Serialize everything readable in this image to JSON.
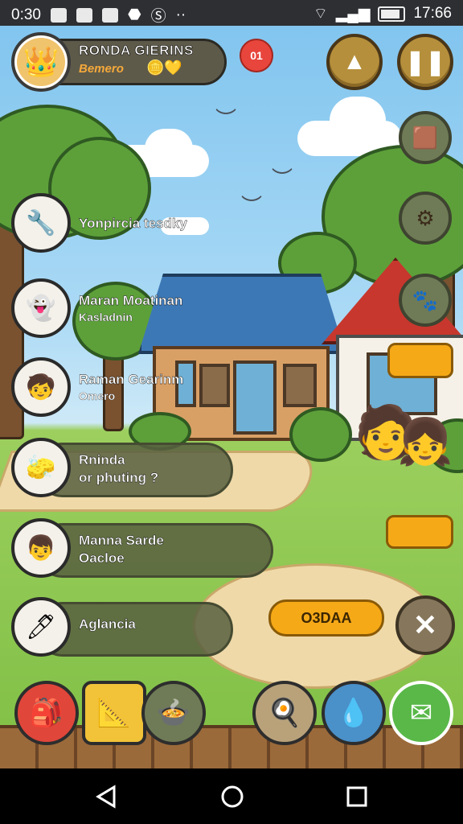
{
  "status_bar": {
    "left_time": "0:30",
    "clock": "17:66"
  },
  "profile": {
    "name": "RONDA GIERINS",
    "subtitle": "Bemero",
    "avatar_icon": "king-avatar-icon"
  },
  "notification_badge": "01",
  "header_buttons": [
    {
      "name": "home-icon",
      "glyph": "▲"
    },
    {
      "name": "pause-icon",
      "glyph": "❚❚"
    }
  ],
  "list_items": [
    {
      "title": "Yonpircia tesdky",
      "subtitle": "",
      "icon": "tool-icon",
      "glyph": "🔧"
    },
    {
      "title": "Maran Moatinan",
      "subtitle": "Kasladnin",
      "icon": "ghost-icon",
      "glyph": "👻"
    },
    {
      "title": "Raman Gearinm",
      "subtitle": "Omero",
      "icon": "boy-avatar-icon",
      "glyph": "🧒"
    },
    {
      "title": "Rninda",
      "subtitle": "or phuting ?",
      "icon": "eraser-icon",
      "glyph": "🧽"
    },
    {
      "title": "Manna Sarde",
      "subtitle": "Oacloe",
      "icon": "boy-avatar-icon",
      "glyph": "👦"
    },
    {
      "title": "Aglancia",
      "subtitle": "",
      "icon": "pen-icon",
      "glyph": "🖊"
    }
  ],
  "action_button_label": "O3DAA",
  "toolbar": [
    {
      "name": "backpack-icon",
      "glyph": "🎒",
      "bg": "#e0463a"
    },
    {
      "name": "ruler-pencil-icon",
      "glyph": "📐",
      "bg": "#f2c238"
    },
    {
      "name": "bowl-icon",
      "glyph": "🍲",
      "bg": "#6f7b56"
    },
    {
      "name": "egg-icon",
      "glyph": "🍳",
      "bg": "#b9a27a"
    },
    {
      "name": "water-drop-icon",
      "glyph": "💧",
      "bg": "#4a90c9"
    },
    {
      "name": "mail-icon",
      "glyph": "✉",
      "bg": "#59b848"
    }
  ],
  "colors": {
    "accent": "#f6a917",
    "panel": "#5e5a4a"
  }
}
